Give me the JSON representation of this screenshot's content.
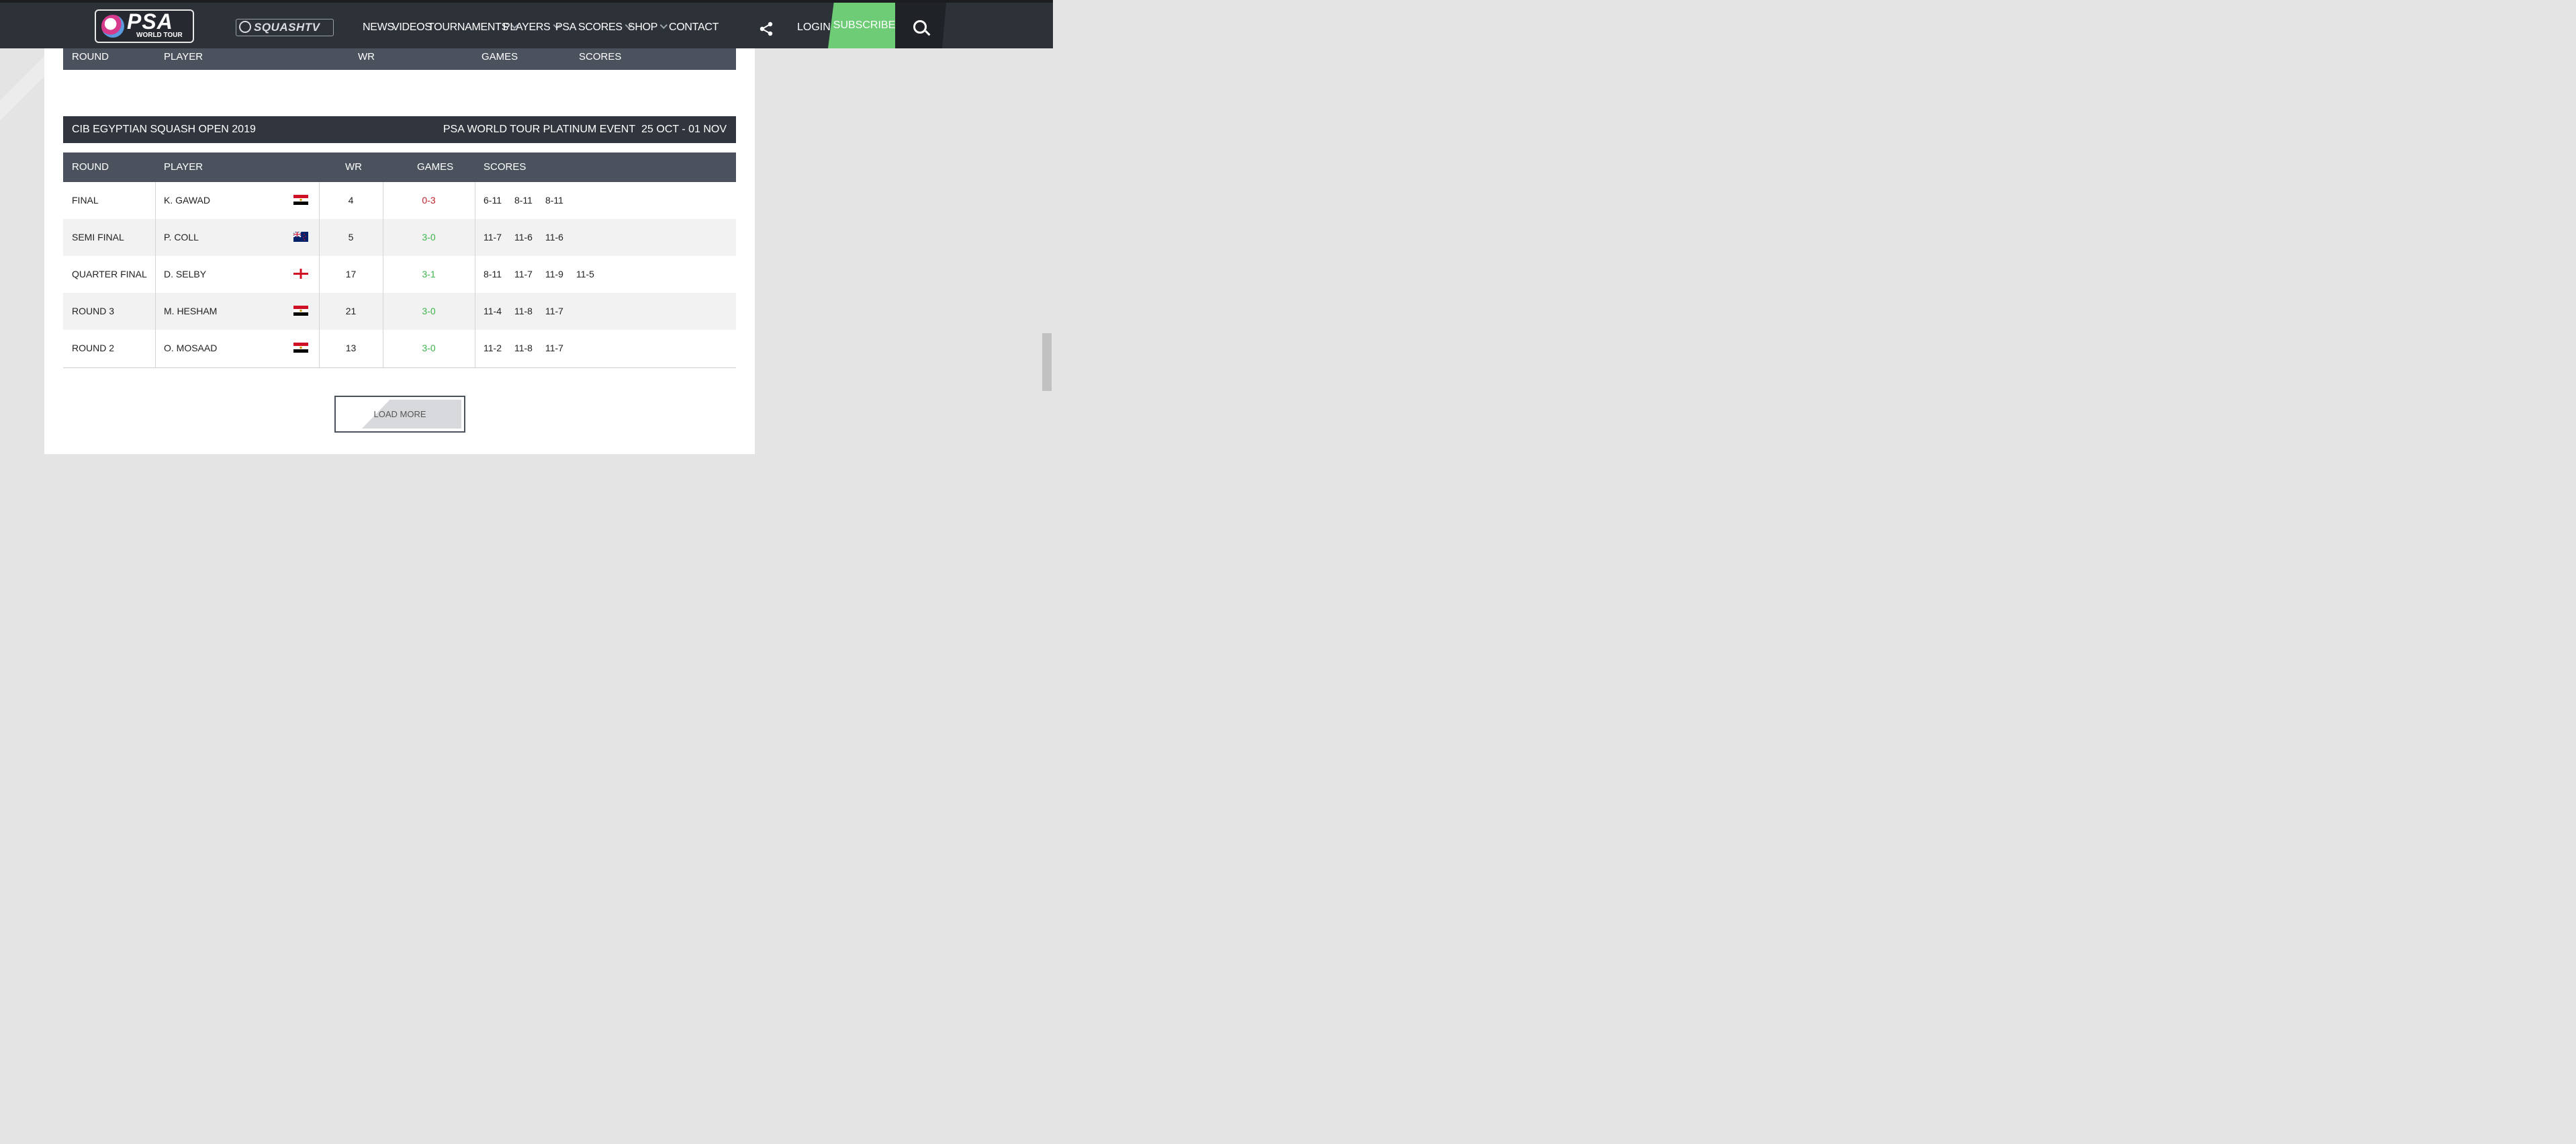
{
  "nav": {
    "logo_main": "PSA",
    "logo_sub": "WORLD TOUR",
    "squashtv": "SQUASHTV",
    "items": [
      {
        "label": "NEWS"
      },
      {
        "label": "VIDEOS"
      },
      {
        "label": "TOURNAMENTS"
      },
      {
        "label": "PLAYERS"
      },
      {
        "label": "PSA"
      },
      {
        "label": "SCORES"
      },
      {
        "label": "SHOP"
      },
      {
        "label": "CONTACT"
      }
    ],
    "login": "LOGIN",
    "subscribe": "SUBSCRIBE"
  },
  "table_header": {
    "round": "ROUND",
    "player": "PLAYER",
    "wr": "WR",
    "games": "GAMES",
    "scores": "SCORES"
  },
  "event": {
    "name": "CIB EGYPTIAN SQUASH OPEN 2019",
    "category": "PSA WORLD TOUR PLATINUM EVENT",
    "dates": "25 OCT - 01 NOV"
  },
  "rows": [
    {
      "round": "FINAL",
      "player": "K. GAWAD",
      "flag": "egypt",
      "wr": "4",
      "games": "0-3",
      "result": "loss",
      "scores": [
        "6-11",
        "8-11",
        "8-11",
        ""
      ]
    },
    {
      "round": "SEMI FINAL",
      "player": "P. COLL",
      "flag": "new-zealand",
      "wr": "5",
      "games": "3-0",
      "result": "win",
      "scores": [
        "11-7",
        "11-6",
        "11-6",
        ""
      ]
    },
    {
      "round": "QUARTER FINAL",
      "player": "D. SELBY",
      "flag": "england",
      "wr": "17",
      "games": "3-1",
      "result": "win",
      "scores": [
        "8-11",
        "11-7",
        "11-9",
        "11-5"
      ]
    },
    {
      "round": "ROUND 3",
      "player": "M. HESHAM",
      "flag": "egypt",
      "wr": "21",
      "games": "3-0",
      "result": "win",
      "scores": [
        "11-4",
        "11-8",
        "11-7",
        ""
      ]
    },
    {
      "round": "ROUND 2",
      "player": "O. MOSAAD",
      "flag": "egypt",
      "wr": "13",
      "games": "3-0",
      "result": "win",
      "scores": [
        "11-2",
        "11-8",
        "11-7",
        ""
      ]
    }
  ],
  "load_more": "LOAD MORE",
  "colors": {
    "win": "#3bb54a",
    "loss": "#c0202a",
    "subscribe": "#6ecb76",
    "nav_bg": "#2d3138"
  }
}
